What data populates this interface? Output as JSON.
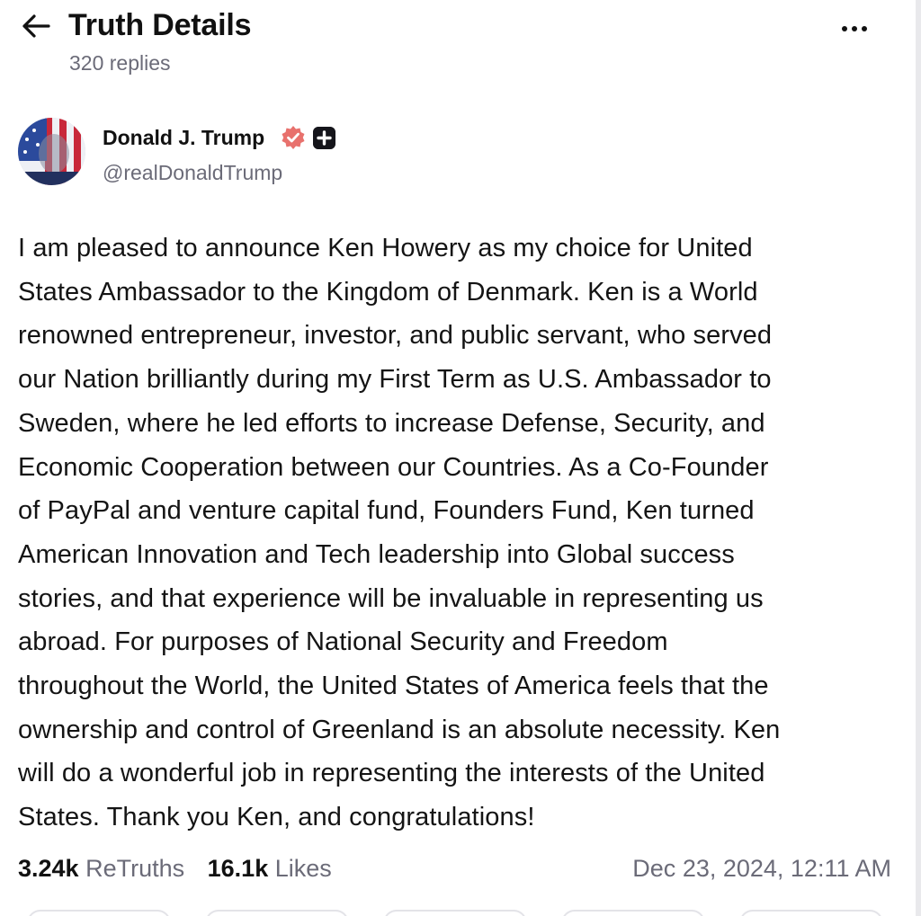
{
  "header": {
    "title": "Truth Details",
    "replies": "320 replies"
  },
  "author": {
    "name": "Donald J. Trump",
    "handle": "@realDonaldTrump",
    "verified_color": "#e8716d"
  },
  "post": {
    "lines": [
      "I am pleased to announce Ken Howery as my choice for United",
      "States Ambassador to the Kingdom of Denmark. Ken is a World",
      "renowned entrepreneur, investor, and public servant, who served",
      "our Nation brilliantly during my First Term as U.S. Ambassador to",
      "Sweden, where he led efforts to increase Defense, Security, and",
      "Economic Cooperation between our Countries. As a Co-Founder",
      "of PayPal and venture capital fund, Founders Fund, Ken turned",
      "American Innovation and Tech leadership into Global success",
      "stories, and that experience will be invaluable in representing us",
      "abroad. For purposes of National Security and Freedom",
      "throughout the World, the United States of America feels that the",
      "ownership and control of Greenland is an absolute necessity. Ken",
      "will do a wonderful job in representing the interests of the United",
      "States. Thank you Ken, and congratulations!"
    ]
  },
  "stats": {
    "retruths_count": "3.24k",
    "retruths_label": "ReTruths",
    "likes_count": "16.1k",
    "likes_label": "Likes",
    "timestamp": "Dec 23, 2024, 12:11 AM"
  },
  "icons": {
    "back": "arrow-left-icon",
    "more": "more-horizontal-icon",
    "verified": "verified-badge-icon",
    "plus": "truth-plus-icon"
  }
}
